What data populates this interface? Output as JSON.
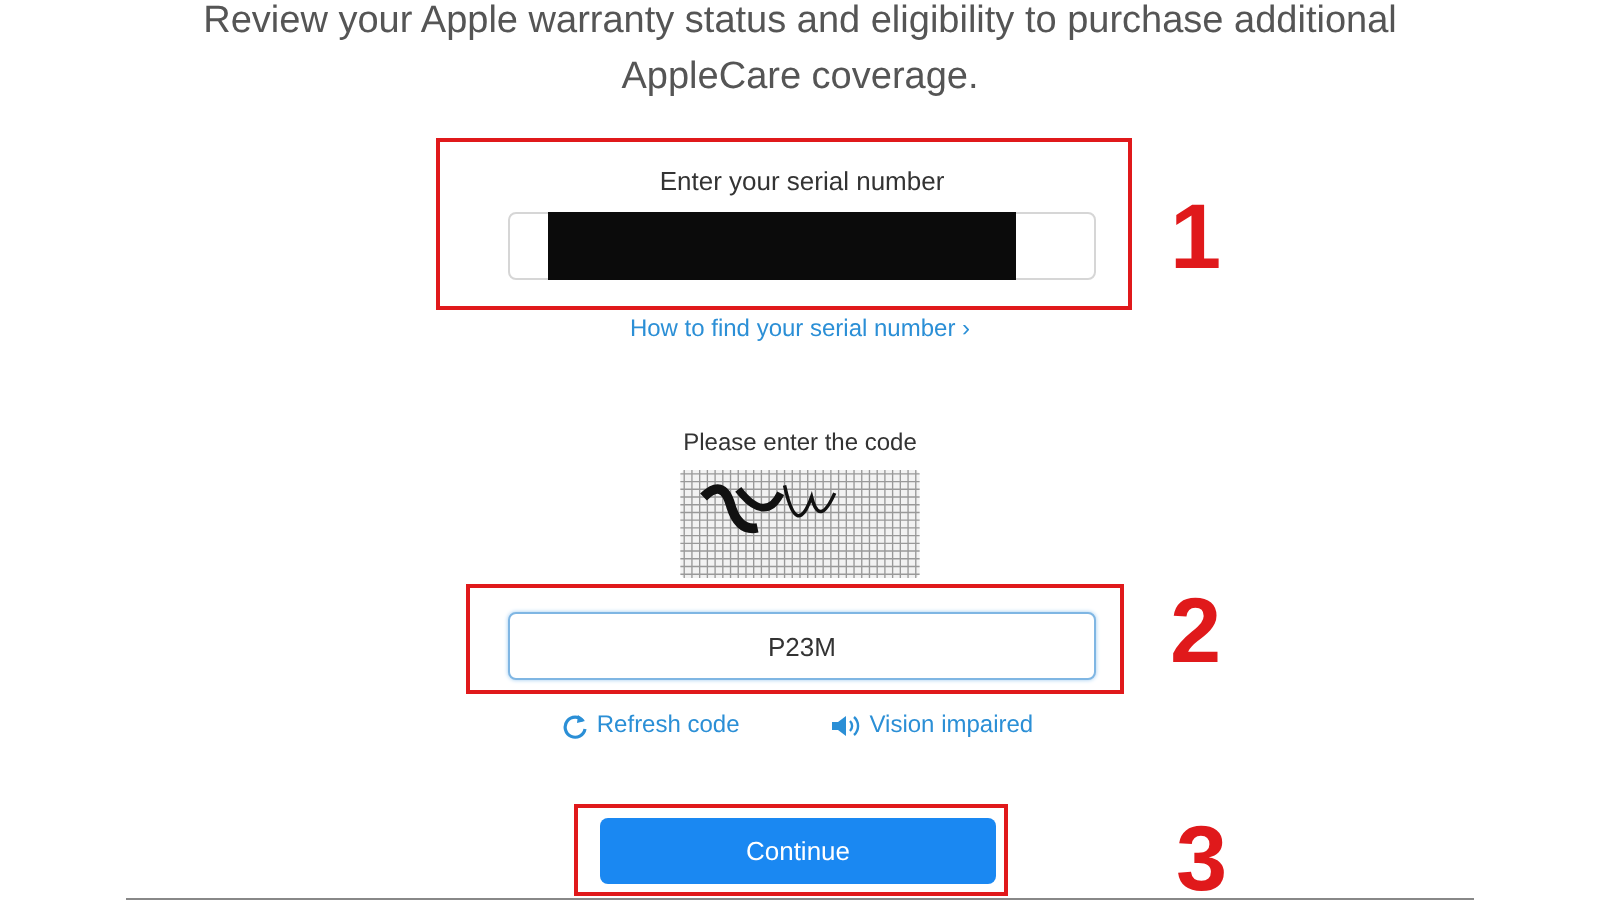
{
  "intro": "Review your Apple warranty status and eligibility to purchase additional AppleCare coverage.",
  "serial": {
    "label": "Enter your serial number",
    "redacted": true,
    "help_link": "How to find your serial number ›"
  },
  "captcha": {
    "label": "Please enter the code",
    "value": "P23M",
    "focused": true
  },
  "captcha_links": [
    {
      "kind": "refresh",
      "label": "Refresh code"
    },
    {
      "kind": "audio",
      "label": "Vision impaired"
    }
  ],
  "continue_button": "Continue",
  "annotations": [
    {
      "number": "1"
    },
    {
      "number": "2"
    },
    {
      "number": "3"
    }
  ]
}
